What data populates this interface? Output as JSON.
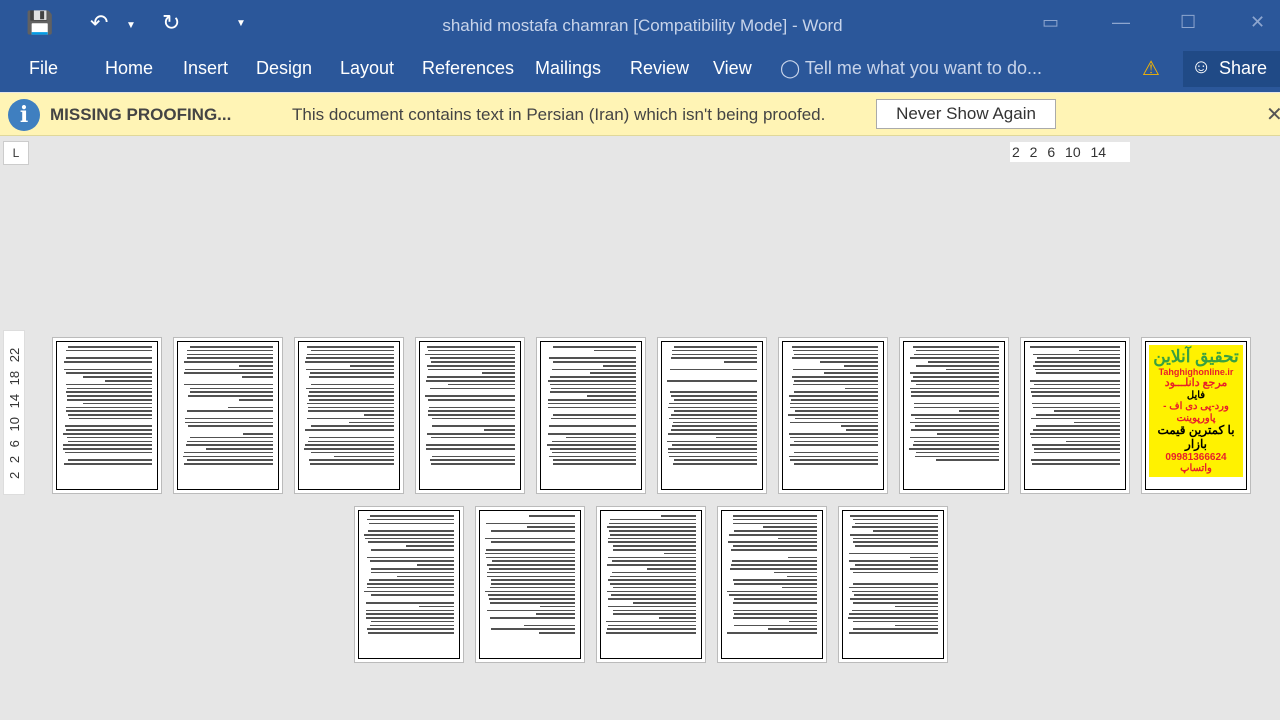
{
  "titlebar": {
    "title": "shahid mostafa chamran [Compatibility Mode] - Word",
    "qa": [
      "save-icon",
      "undo-icon",
      "redo-icon",
      "customize-icon"
    ]
  },
  "ribbon": {
    "tabs": [
      "File",
      "Home",
      "Insert",
      "Design",
      "Layout",
      "References",
      "Mailings",
      "Review",
      "View"
    ],
    "tell_me": "Tell me what you want to do...",
    "share": "Share"
  },
  "message_bar": {
    "title": "MISSING PROOFING...",
    "text": "This document contains text in Persian (Iran) which isn't being proofed.",
    "button": "Never Show Again"
  },
  "ruler": {
    "horizontal": "2 2 6 10 14",
    "vertical": "2 2 6 10 14 18 22",
    "tab_selector": "L"
  },
  "ad_page": {
    "line1": "تحقیق آنلاین",
    "line2": "Tahghighonline.ir",
    "line3": "مرجع دانلـــود",
    "line4": "فایل",
    "line5": "ورد-پی دی اف - پاورپوینت",
    "line6": "با کمترین قیمت بازار",
    "line7": "09981366624 واتساپ"
  },
  "colors": {
    "ribbon": "#2b579a",
    "message_bar": "#fff4b5",
    "ad_bg": "#fff200",
    "ad_red": "#e8202a"
  }
}
